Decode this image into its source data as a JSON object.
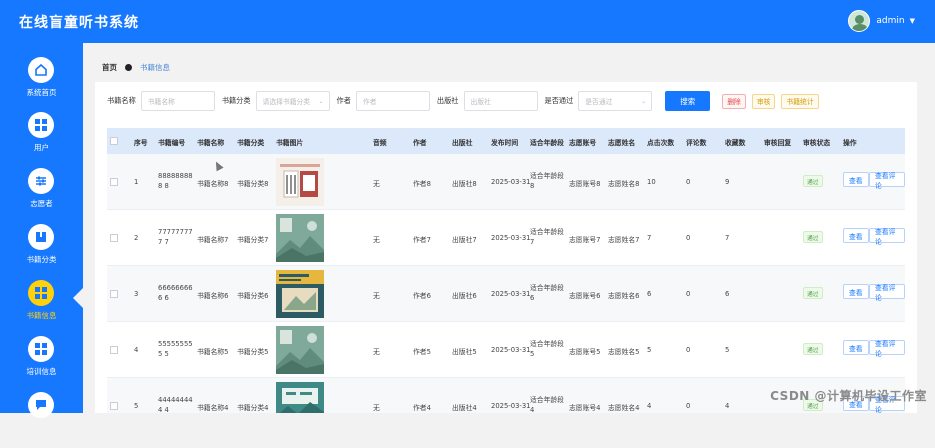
{
  "app": {
    "title": "在线盲童听书系统",
    "username": "admin"
  },
  "sidebar": {
    "items": [
      {
        "label": "系统首页",
        "icon": "home-icon"
      },
      {
        "label": "用户",
        "icon": "grid-icon"
      },
      {
        "label": "志愿者",
        "icon": "sliders-icon"
      },
      {
        "label": "书籍分类",
        "icon": "book-icon"
      },
      {
        "label": "书籍信息",
        "icon": "grid-icon",
        "active": true
      },
      {
        "label": "培训信息",
        "icon": "grid-icon"
      },
      {
        "label": "",
        "icon": "chat-icon"
      }
    ]
  },
  "breadcrumb": {
    "home": "首页",
    "current": "书籍信息"
  },
  "search": {
    "name_label": "书籍名称",
    "name_placeholder": "书籍名称",
    "category_label": "书籍分类",
    "category_placeholder": "请选择书籍分类",
    "author_label": "作者",
    "author_placeholder": "作者",
    "publisher_label": "出版社",
    "publisher_placeholder": "出版社",
    "approved_label": "是否通过",
    "approved_placeholder": "是否通过",
    "search_btn": "搜索",
    "delete_btn": "删除",
    "audit_btn": "审核",
    "stats_btn": "书籍统计"
  },
  "table": {
    "headers": [
      "序号",
      "书籍编号",
      "书籍名称",
      "书籍分类",
      "书籍图片",
      "音频",
      "作者",
      "出版社",
      "发布时间",
      "适合年龄段",
      "志愿账号",
      "志愿姓名",
      "点击次数",
      "评论数",
      "收藏数",
      "审核回复",
      "审核状态",
      "操作"
    ],
    "rows": [
      {
        "index": "1",
        "code": "888888888 8",
        "name": "书籍名称8",
        "category": "书籍分类8",
        "audio": "无",
        "author": "作者8",
        "publisher": "出版社8",
        "date": "2025-03-31",
        "age": "适合年龄段 8",
        "vol_account": "志愿账号8",
        "vol_name": "志愿姓名8",
        "clicks": "10",
        "comments": "0",
        "favorites": "9",
        "status": "通过"
      },
      {
        "index": "2",
        "code": "777777777 7",
        "name": "书籍名称7",
        "category": "书籍分类7",
        "audio": "无",
        "author": "作者7",
        "publisher": "出版社7",
        "date": "2025-03-31",
        "age": "适合年龄段 7",
        "vol_account": "志愿账号7",
        "vol_name": "志愿姓名7",
        "clicks": "7",
        "comments": "0",
        "favorites": "7",
        "status": "通过"
      },
      {
        "index": "3",
        "code": "666666666 6",
        "name": "书籍名称6",
        "category": "书籍分类6",
        "audio": "无",
        "author": "作者6",
        "publisher": "出版社6",
        "date": "2025-03-31",
        "age": "适合年龄段 6",
        "vol_account": "志愿账号6",
        "vol_name": "志愿姓名6",
        "clicks": "6",
        "comments": "0",
        "favorites": "6",
        "status": "通过"
      },
      {
        "index": "4",
        "code": "555555555 5",
        "name": "书籍名称5",
        "category": "书籍分类5",
        "audio": "无",
        "author": "作者5",
        "publisher": "出版社5",
        "date": "2025-03-31",
        "age": "适合年龄段 5",
        "vol_account": "志愿账号5",
        "vol_name": "志愿姓名5",
        "clicks": "5",
        "comments": "0",
        "favorites": "5",
        "status": "通过"
      },
      {
        "index": "5",
        "code": "444444444 4",
        "name": "书籍名称4",
        "category": "书籍分类4",
        "audio": "无",
        "author": "作者4",
        "publisher": "出版社4",
        "date": "2025-03-31",
        "age": "适合年龄段 4",
        "vol_account": "志愿账号4",
        "vol_name": "志愿姓名4",
        "clicks": "4",
        "comments": "0",
        "favorites": "4",
        "status": "通过"
      }
    ],
    "view_btn": "查看",
    "view_comments_btn": "查看评论"
  },
  "watermark": "CSDN @计算机毕设工作室"
}
